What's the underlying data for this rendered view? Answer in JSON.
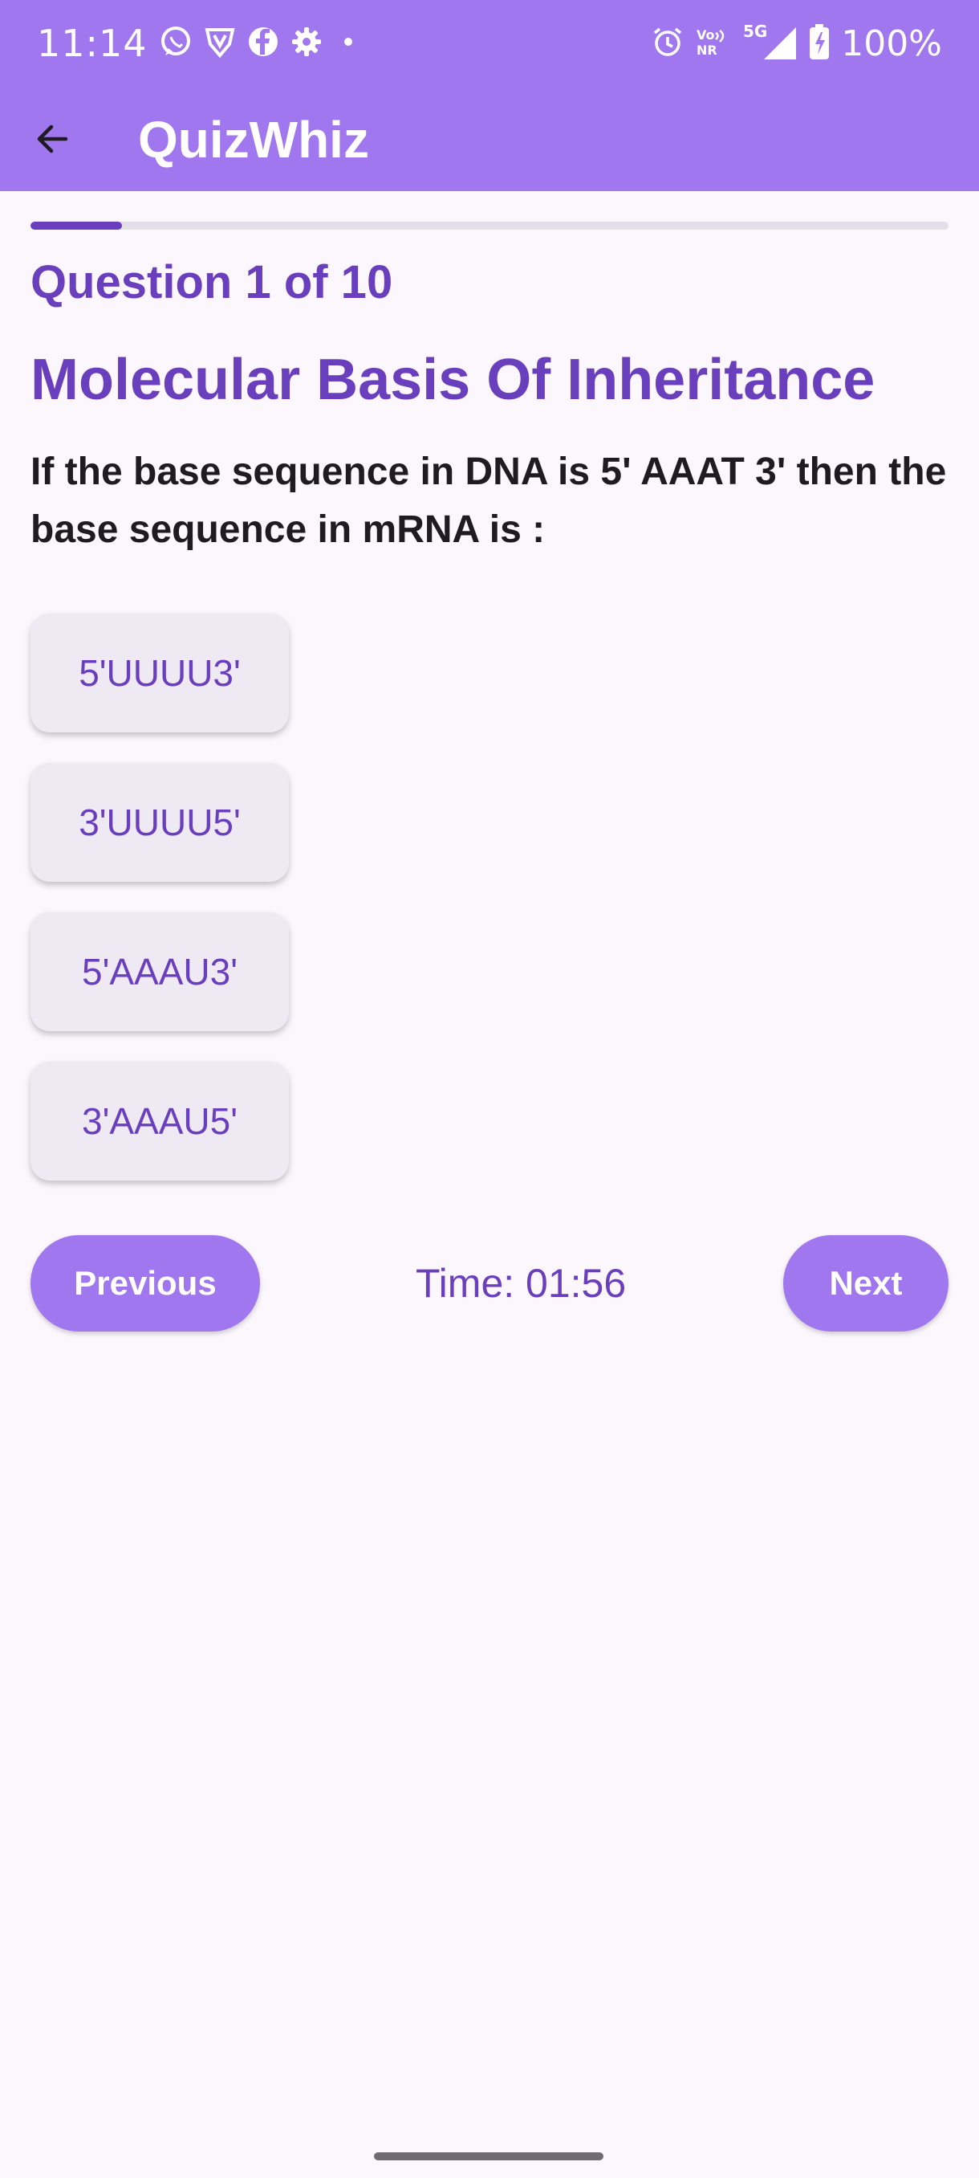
{
  "status_bar": {
    "time": "11:14",
    "left_icons": [
      "whatsapp-icon",
      "vpn-shield-icon",
      "facebook-icon",
      "settings-gear-icon",
      "notification-dot-icon"
    ],
    "right_icons": [
      "alarm-icon",
      "vonr-icon",
      "5g-signal-icon",
      "battery-charging-icon"
    ],
    "network_label": "5G",
    "vonr_label_top": "Vo",
    "vonr_label_bottom": "NR",
    "battery": "100%"
  },
  "app_bar": {
    "title": "QuizWhiz",
    "back_icon": "arrow-left-icon"
  },
  "quiz": {
    "progress_fraction": 0.1,
    "counter": "Question 1 of 10",
    "topic": "Molecular Basis Of Inheritance",
    "question": "If the base sequence in DNA is 5' AAAT 3' then the base sequence in mRNA is :",
    "options": [
      "5'UUUU3'",
      "3'UUUU5'",
      "5'AAAU3'",
      "3'AAAU5'"
    ]
  },
  "navigation": {
    "previous_label": "Previous",
    "timer": "Time: 01:56",
    "next_label": "Next"
  },
  "colors": {
    "primary": "#a077ee",
    "accent_text": "#6a3fbd",
    "background": "#fcf6fd",
    "option_bg": "#efe9f3"
  }
}
